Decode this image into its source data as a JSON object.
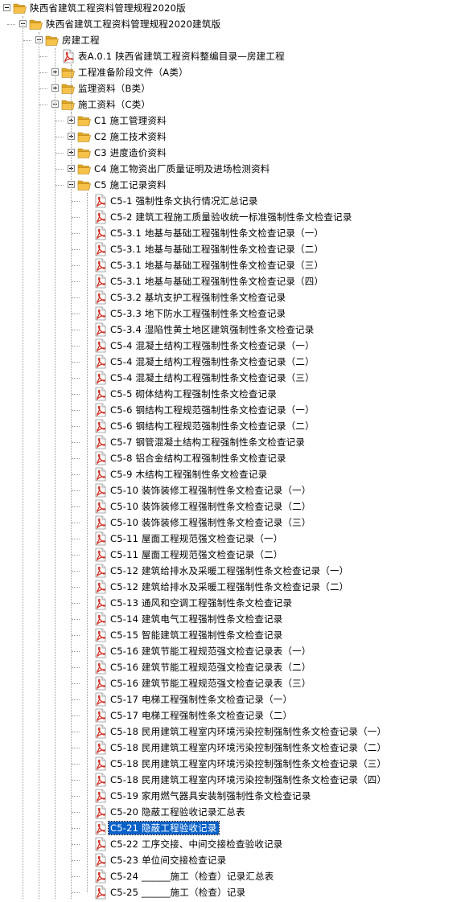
{
  "tree": {
    "nodes": [
      {
        "label": "陕西省建筑工程资料管理规程2020版",
        "type": "folder",
        "expander": "minus",
        "level": 0
      },
      {
        "label": "陕西省建筑工程资料管理规程2020建筑版",
        "type": "folder",
        "expander": "minus",
        "level": 1
      },
      {
        "label": "房建工程",
        "type": "folder",
        "expander": "minus",
        "level": 2
      },
      {
        "label": "表A.0.1 陕西省建筑工程资料整编目录—房建工程",
        "type": "pdf",
        "level": 3
      },
      {
        "label": "工程准备阶段文件（A类）",
        "type": "folder",
        "expander": "plus",
        "level": 3
      },
      {
        "label": "监理资料（B类）",
        "type": "folder",
        "expander": "plus",
        "level": 3
      },
      {
        "label": "施工资料（C类）",
        "type": "folder",
        "expander": "minus",
        "level": 3
      },
      {
        "label": "C1 施工管理资料",
        "type": "folder",
        "expander": "plus",
        "level": 4
      },
      {
        "label": "C2 施工技术资料",
        "type": "folder",
        "expander": "plus",
        "level": 4
      },
      {
        "label": "C3 进度造价资料",
        "type": "folder",
        "expander": "plus",
        "level": 4
      },
      {
        "label": "C4 施工物资出厂质量证明及进场检测资料",
        "type": "folder",
        "expander": "plus",
        "level": 4
      },
      {
        "label": "C5 施工记录资料",
        "type": "folder",
        "expander": "minus",
        "level": 4
      },
      {
        "label": "C5-1 强制性条文执行情况汇总记录",
        "type": "pdf",
        "level": 5
      },
      {
        "label": "C5-2 建筑工程施工质量验收统一标准强制性条文检查记录",
        "type": "pdf",
        "level": 5
      },
      {
        "label": "C5-3.1 地基与基础工程强制性条文检查记录（一）",
        "type": "pdf",
        "level": 5
      },
      {
        "label": "C5-3.1 地基与基础工程强制性条文检查记录（二）",
        "type": "pdf",
        "level": 5
      },
      {
        "label": "C5-3.1 地基与基础工程强制性条文检查记录（三）",
        "type": "pdf",
        "level": 5
      },
      {
        "label": "C5-3.1 地基与基础工程强制性条文检查记录（四）",
        "type": "pdf",
        "level": 5
      },
      {
        "label": "C5-3.2 基坑支护工程强制性条文检查记录",
        "type": "pdf",
        "level": 5
      },
      {
        "label": "C5-3.3 地下防水工程强制性条文检查记录",
        "type": "pdf",
        "level": 5
      },
      {
        "label": "C5-3.4 湿陷性黄土地区建筑强制性条文检查记录",
        "type": "pdf",
        "level": 5
      },
      {
        "label": "C5-4 混凝土结构工程强制性条文检查记录（一）",
        "type": "pdf",
        "level": 5
      },
      {
        "label": "C5-4 混凝土结构工程强制性条文检查记录（二）",
        "type": "pdf",
        "level": 5
      },
      {
        "label": "C5-4 混凝土结构工程强制性条文检查记录（三）",
        "type": "pdf",
        "level": 5
      },
      {
        "label": "C5-5 砌体结构工程强制性条文检查记录",
        "type": "pdf",
        "level": 5
      },
      {
        "label": "C5-6 钢结构工程规范强制性条文检查记录（一）",
        "type": "pdf",
        "level": 5
      },
      {
        "label": "C5-6 钢结构工程规范强制性条文检查记录（二）",
        "type": "pdf",
        "level": 5
      },
      {
        "label": "C5-7 钢管混凝土结构工程强制性条文检查记录",
        "type": "pdf",
        "level": 5
      },
      {
        "label": "C5-8 铝合金结构工程强制性条文检查记录",
        "type": "pdf",
        "level": 5
      },
      {
        "label": "C5-9 木结构工程强制性条文检查记录",
        "type": "pdf",
        "level": 5
      },
      {
        "label": "C5-10 装饰装修工程强制性条文检查记录（一）",
        "type": "pdf",
        "level": 5
      },
      {
        "label": "C5-10 装饰装修工程强制性条文检查记录（二）",
        "type": "pdf",
        "level": 5
      },
      {
        "label": "C5-10 装饰装修工程强制性条文检查记录（三）",
        "type": "pdf",
        "level": 5
      },
      {
        "label": "C5-11 屋面工程规范强文检查记录（一）",
        "type": "pdf",
        "level": 5
      },
      {
        "label": "C5-11 屋面工程规范强文检查记录（二）",
        "type": "pdf",
        "level": 5
      },
      {
        "label": "C5-12 建筑给排水及采暖工程强制性条文检查记录（一）",
        "type": "pdf",
        "level": 5
      },
      {
        "label": "C5-12 建筑给排水及采暖工程强制性条文检查记录（二）",
        "type": "pdf",
        "level": 5
      },
      {
        "label": "C5-13 通风和空调工程强制性条文检查记录",
        "type": "pdf",
        "level": 5
      },
      {
        "label": "C5-14 建筑电气工程强制性条文检查记录",
        "type": "pdf",
        "level": 5
      },
      {
        "label": "C5-15 智能建筑工程强制性条文检查记录",
        "type": "pdf",
        "level": 5
      },
      {
        "label": "C5-16 建筑节能工程规范强文检查记录表（一）",
        "type": "pdf",
        "level": 5
      },
      {
        "label": "C5-16 建筑节能工程规范强文检查记录表（二）",
        "type": "pdf",
        "level": 5
      },
      {
        "label": "C5-16 建筑节能工程规范强文检查记录表（三）",
        "type": "pdf",
        "level": 5
      },
      {
        "label": "C5-17 电梯工程强制性条文检查记录（一）",
        "type": "pdf",
        "level": 5
      },
      {
        "label": "C5-17 电梯工程强制性条文检查记录（二）",
        "type": "pdf",
        "level": 5
      },
      {
        "label": "C5-18 民用建筑工程室内环境污染控制强制性条文检查记录（一）",
        "type": "pdf",
        "level": 5
      },
      {
        "label": "C5-18 民用建筑工程室内环境污染控制强制性条文检查记录（二）",
        "type": "pdf",
        "level": 5
      },
      {
        "label": "C5-18 民用建筑工程室内环境污染控制强制性条文检查记录（三）",
        "type": "pdf",
        "level": 5
      },
      {
        "label": "C5-18 民用建筑工程室内环境污染控制强制性条文检查记录（四）",
        "type": "pdf",
        "level": 5
      },
      {
        "label": "C5-19 家用燃气器具安装制强制性条文检查记录",
        "type": "pdf",
        "level": 5
      },
      {
        "label": "C5-20 隐蔽工程验收记录汇总表",
        "type": "pdf",
        "level": 5
      },
      {
        "label": "C5-21 隐蔽工程验收记录",
        "type": "pdf",
        "level": 5,
        "selected": true
      },
      {
        "label": "C5-22 工序交接、中间交接检查验收记录",
        "type": "pdf",
        "level": 5
      },
      {
        "label": "C5-23 单位间交接检查记录",
        "type": "pdf",
        "level": 5
      },
      {
        "label": "C5-24 ______施工（检查）记录汇总表",
        "type": "pdf",
        "level": 5
      },
      {
        "label": "C5-25 ______施工（检查）记录",
        "type": "pdf",
        "level": 5
      }
    ]
  },
  "colors": {
    "selection": "#0a61c7",
    "folder": "#f6c24a",
    "pdf": "#d22b1f",
    "treeline": "#9a9a9a"
  },
  "icons": {
    "folder": "open-folder-icon",
    "pdf": "pdf-file-icon",
    "expander_plus": "plus-expander-icon",
    "expander_minus": "minus-expander-icon"
  }
}
